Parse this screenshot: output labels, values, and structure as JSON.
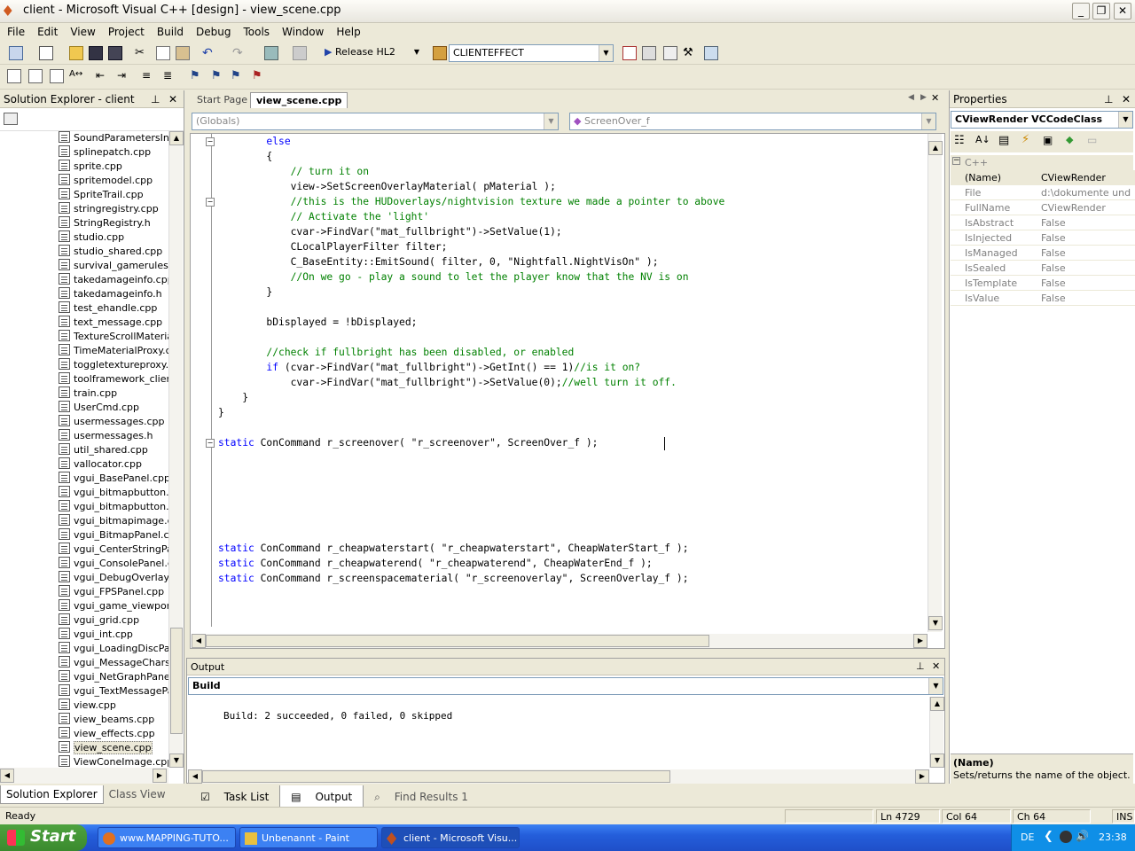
{
  "window": {
    "title": "client - Microsoft Visual C++ [design] - view_scene.cpp"
  },
  "menu": [
    "File",
    "Edit",
    "View",
    "Project",
    "Build",
    "Debug",
    "Tools",
    "Window",
    "Help"
  ],
  "toolbar": {
    "config": "Release HL2",
    "project": "CLIENTEFFECT"
  },
  "solution_explorer": {
    "title": "Solution Explorer - client",
    "items": [
      "SoundParametersInte",
      "splinepatch.cpp",
      "sprite.cpp",
      "spritemodel.cpp",
      "SpriteTrail.cpp",
      "stringregistry.cpp",
      "StringRegistry.h",
      "studio.cpp",
      "studio_shared.cpp",
      "survival_gamerules.cp",
      "takedamageinfo.cpp",
      "takedamageinfo.h",
      "test_ehandle.cpp",
      "text_message.cpp",
      "TextureScrollMaterialP",
      "TimeMaterialProxy.cpp",
      "toggletextureproxy.cp",
      "toolframework_client.",
      "train.cpp",
      "UserCmd.cpp",
      "usermessages.cpp",
      "usermessages.h",
      "util_shared.cpp",
      "vallocator.cpp",
      "vgui_BasePanel.cpp",
      "vgui_bitmapbutton.cp",
      "vgui_bitmapbutton.h",
      "vgui_bitmapimage.cpp",
      "vgui_BitmapPanel.cpp",
      "vgui_CenterStringPan",
      "vgui_ConsolePanel.cp",
      "vgui_DebugOverlayPa",
      "vgui_FPSPanel.cpp",
      "vgui_game_viewport.",
      "vgui_grid.cpp",
      "vgui_int.cpp",
      "vgui_LoadingDiscPane",
      "vgui_MessageChars.c",
      "vgui_NetGraphPanel.c",
      "vgui_TextMessagePar",
      "view.cpp",
      "view_beams.cpp",
      "view_effects.cpp",
      "view_scene.cpp",
      "ViewConeImage.cpp"
    ],
    "tabs": [
      "Solution Explorer",
      "Class View"
    ]
  },
  "editor": {
    "tabs": [
      "Start Page",
      "view_scene.cpp"
    ],
    "scope_combo": "(Globals)",
    "member_combo": "ScreenOver_f",
    "lines": [
      {
        "t": "        else",
        "c": "kw"
      },
      {
        "t": "        {",
        "c": ""
      },
      {
        "t": "            // turn it on",
        "c": "cm"
      },
      {
        "t": "            view->SetScreenOverlayMaterial( pMaterial );",
        "c": ""
      },
      {
        "t": "            //this is the HUDoverlays/nightvision texture we made a pointer to above",
        "c": "cm"
      },
      {
        "t": "            // Activate the 'light'",
        "c": "cm"
      },
      {
        "t": "            cvar->FindVar(\"mat_fullbright\")->SetValue(1);",
        "c": ""
      },
      {
        "t": "            CLocalPlayerFilter filter;",
        "c": ""
      },
      {
        "t": "            C_BaseEntity::EmitSound( filter, 0, \"Nightfall.NightVisOn\" );",
        "c": ""
      },
      {
        "t": "            //On we go - play a sound to let the player know that the NV is on",
        "c": "cm"
      },
      {
        "t": "        }",
        "c": ""
      },
      {
        "t": "",
        "c": ""
      },
      {
        "t": "        bDisplayed = !bDisplayed;",
        "c": ""
      },
      {
        "t": "",
        "c": ""
      },
      {
        "t": "        //check if fullbright has been disabled, or enabled",
        "c": "cm"
      },
      {
        "t": "        if (cvar->FindVar(\"mat_fullbright\")->GetInt() == 1)//is it on?",
        "c": "mix1"
      },
      {
        "t": "            cvar->FindVar(\"mat_fullbright\")->SetValue(0);//well turn it off.",
        "c": "mix2"
      },
      {
        "t": "    }",
        "c": ""
      },
      {
        "t": "}",
        "c": ""
      },
      {
        "t": "",
        "c": ""
      },
      {
        "t": "static ConCommand r_screenover( \"r_screenover\", ScreenOver_f );",
        "c": "static"
      },
      {
        "t": "",
        "c": ""
      },
      {
        "t": "",
        "c": ""
      },
      {
        "t": "",
        "c": ""
      },
      {
        "t": "",
        "c": ""
      },
      {
        "t": "",
        "c": ""
      },
      {
        "t": "",
        "c": ""
      },
      {
        "t": "static ConCommand r_cheapwaterstart( \"r_cheapwaterstart\", CheapWaterStart_f );",
        "c": "static"
      },
      {
        "t": "static ConCommand r_cheapwaterend( \"r_cheapwaterend\", CheapWaterEnd_f );",
        "c": "static"
      },
      {
        "t": "static ConCommand r_screenspacematerial( \"r_screenoverlay\", ScreenOverlay_f );",
        "c": "static"
      }
    ]
  },
  "properties": {
    "title": "Properties",
    "object": "CViewRender  VCCodeClass",
    "category": "C++",
    "rows": [
      {
        "name": "(Name)",
        "value": "CViewRender"
      },
      {
        "name": "File",
        "value": "d:\\dokumente und ein"
      },
      {
        "name": "FullName",
        "value": "CViewRender"
      },
      {
        "name": "IsAbstract",
        "value": "False"
      },
      {
        "name": "IsInjected",
        "value": "False"
      },
      {
        "name": "IsManaged",
        "value": "False"
      },
      {
        "name": "IsSealed",
        "value": "False"
      },
      {
        "name": "IsTemplate",
        "value": "False"
      },
      {
        "name": "IsValue",
        "value": "False"
      }
    ],
    "desc_title": "(Name)",
    "desc_text": "Sets/returns the name of the object."
  },
  "output": {
    "title": "Output",
    "source": "Build",
    "text": "Build: 2 succeeded, 0 failed, 0 skipped",
    "tabs": [
      "Task List",
      "Output",
      "Find Results 1"
    ]
  },
  "status": {
    "text": "Ready",
    "ln": "Ln 4729",
    "col": "Col 64",
    "ch": "Ch 64",
    "mode": "INS"
  },
  "taskbar": {
    "start": "Start",
    "buttons": [
      "www.MAPPING-TUTO...",
      "Unbenannt - Paint",
      "client - Microsoft Visu..."
    ],
    "lang": "DE",
    "time": "23:38"
  }
}
